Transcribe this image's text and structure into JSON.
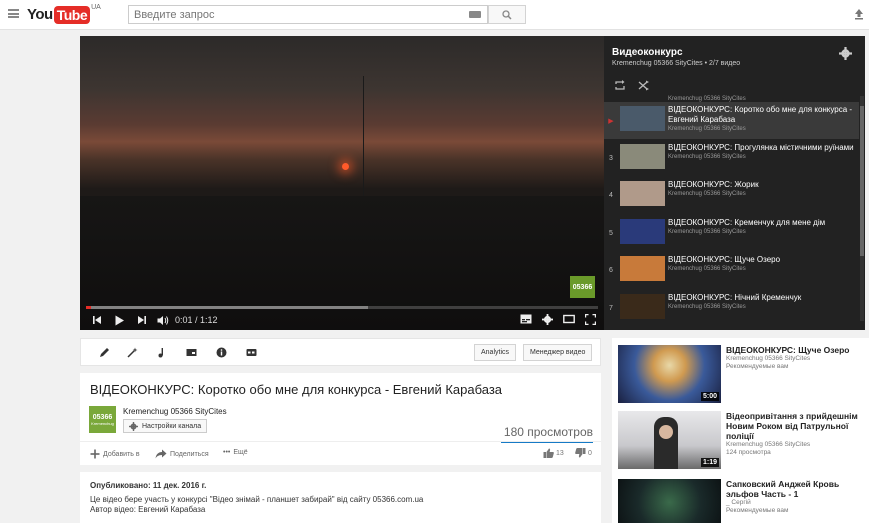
{
  "masthead": {
    "logo_you": "You",
    "logo_tube": "Tube",
    "logo_region": "UA",
    "search_placeholder": "Введите запрос"
  },
  "player": {
    "time": "0:01 / 1:12",
    "watermark": "05366",
    "progress_fraction": 0.01,
    "buffer_fraction": 0.55
  },
  "playlist": {
    "title": "Видеоконкурс",
    "subtitle": "Kremenchug 05366 SityCites • 2/7 видео",
    "cut_author": "Kremenchug 05366 SityCites",
    "items": [
      {
        "index": "▶",
        "title": "ВІДЕОКОНКУРС: Коротко обо мне для конкурса - Евгений Карабаза",
        "author": "Kremenchug 05366 SityCites",
        "active": true,
        "thumb": "#4a5a6a"
      },
      {
        "index": "3",
        "title": "ВІДЕОКОНКУРС: Прогулянка містичними руїнами",
        "author": "Kremenchug 05366 SityCites",
        "active": false,
        "thumb": "#8a8a7a"
      },
      {
        "index": "4",
        "title": "ВІДЕОКОНКУРС: Жорик",
        "author": "Kremenchug 05366 SityCites",
        "active": false,
        "thumb": "#b09a8a"
      },
      {
        "index": "5",
        "title": "ВІДЕОКОНКУРС: Кременчук для мене дім",
        "author": "Kremenchug 05366 SityCites",
        "active": false,
        "thumb": "#2a3a7a"
      },
      {
        "index": "6",
        "title": "ВІДЕОКОНКУРС: Щуче Озеро",
        "author": "Kremenchug 05366 SityCites",
        "active": false,
        "thumb": "#c87a3a"
      },
      {
        "index": "7",
        "title": "ВІДЕОКОНКУРС: Нічний Кременчук",
        "author": "Kremenchug 05366 SityCites",
        "active": false,
        "thumb": "#3a2a1a"
      }
    ]
  },
  "actions": {
    "analytics": "Analytics",
    "video_manager": "Менеджер видео"
  },
  "video": {
    "title": "ВІДЕОКОНКУРС: Коротко обо мне для конкурса - Евгений Карабаза",
    "channel": "Kremenchug 05366 SityCites",
    "channel_avatar_text": "05366",
    "channel_avatar_sub": "Kremenchug",
    "channel_settings": "Настройки канала",
    "views": "180 просмотров",
    "add_to": "Добавить в",
    "share": "Поделиться",
    "more": "Ещё",
    "likes": "13",
    "dislikes": "0"
  },
  "description": {
    "published": "Опубликовано: 11 дек. 2016 г.",
    "line1": "Це відео бере участь у конкурсі \"Відео знімай - планшет забирай\" від сайту 05366.com.ua",
    "line2": "Автор відео: Евгений Карабаза"
  },
  "related": [
    {
      "title": "ВІДЕОКОНКУРС: Щуче Озеро",
      "meta1": "Kremenchug 05366 SityCites",
      "meta2": "Рекомендуемые вам",
      "duration": "5:00"
    },
    {
      "title": "Відеопривітання з прийдешнім Новим Роком від Патрульної поліції",
      "meta1": "Kremenchug 05366 SityCites",
      "meta2": "124 просмотра",
      "duration": "1:19"
    },
    {
      "title": "Сапковский Анджей Кровь эльфов Часть - 1",
      "meta1": "_ Сергій",
      "meta2": "Рекомендуемые вам",
      "duration": ""
    }
  ]
}
